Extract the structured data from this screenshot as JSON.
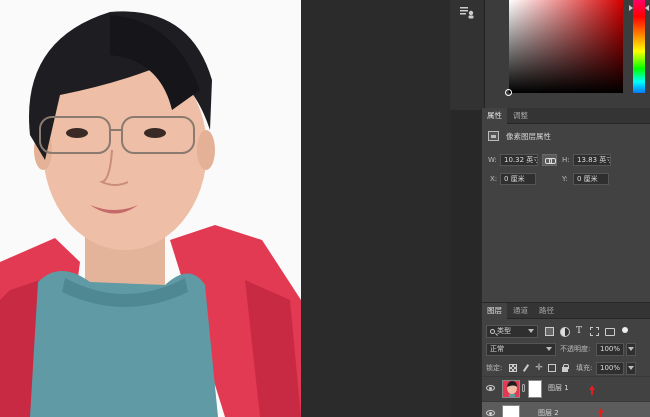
{
  "properties_panel": {
    "tabs": [
      {
        "label": "属性",
        "active": true
      },
      {
        "label": "调整",
        "active": false
      }
    ],
    "subtitle": "像素图层属性",
    "fields": {
      "w_label": "W:",
      "w_value": "10.32 英寸",
      "h_label": "H:",
      "h_value": "13.83 英寸",
      "x_label": "X:",
      "x_value": "0 厘米",
      "y_label": "Y:",
      "y_value": "0 厘米"
    }
  },
  "layers_panel": {
    "tabs": [
      {
        "label": "图层",
        "active": true
      },
      {
        "label": "通道",
        "active": false
      },
      {
        "label": "路径",
        "active": false
      }
    ],
    "filter_kind": "类型",
    "blend_mode": "正常",
    "opacity_label": "不透明度:",
    "opacity_value": "100%",
    "lock_label": "锁定:",
    "fill_label": "填充:",
    "fill_value": "100%",
    "layers": [
      {
        "name": "图层 1"
      },
      {
        "name": "图层 2"
      }
    ]
  },
  "colors": {
    "panel_bg": "#424242",
    "annotation_arrow": "#e02020",
    "jacket": "#e23a52",
    "sweater": "#5f9aa5"
  },
  "icons": [
    "tool-dock-icon",
    "pixel-layer-icon",
    "link-icon",
    "search-icon",
    "eye-icon",
    "lock-icon",
    "chain-link-icon"
  ]
}
